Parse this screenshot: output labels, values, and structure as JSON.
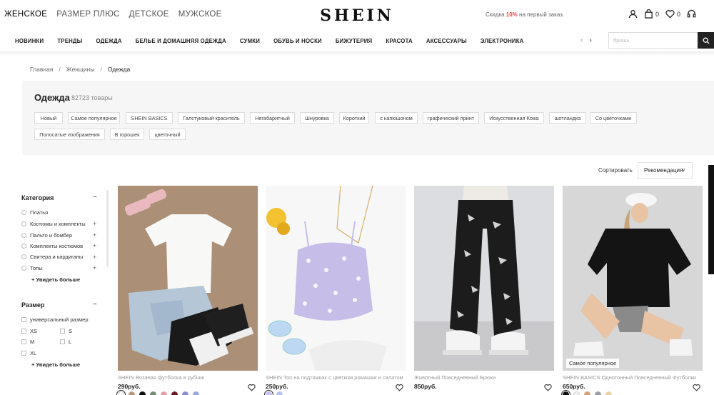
{
  "header": {
    "segments": [
      "ЖЕНСКОЕ",
      "РАЗМЕР ПЛЮС",
      "ДЕТСКОЕ",
      "МУЖСКОЕ"
    ],
    "logo": "SHEIN",
    "promo_prefix": "Скидка",
    "promo_percent": "10%",
    "promo_suffix": "на первый заказ.",
    "cart_count": "0",
    "wishlist_count": "0"
  },
  "nav": {
    "items": [
      "НОВИНКИ",
      "ТРЕНДЫ",
      "ОДЕЖДА",
      "БЕЛЬЕ И ДОМАШНЯЯ ОДЕЖДА",
      "СУМКИ",
      "ОБУВЬ И НОСКИ",
      "БИЖУТЕРИЯ",
      "КРАСОТА",
      "АКСЕССУАРЫ",
      "ЭЛЕКТРОНИКА"
    ],
    "arrow_left": "‹",
    "arrow_right": "›"
  },
  "search": {
    "placeholder": "брошь"
  },
  "breadcrumb": {
    "home": "Главная",
    "women": "Женщины",
    "current": "Одежда",
    "separator": "/"
  },
  "banner": {
    "title": "Одежда",
    "count": "82723 товары",
    "chips": [
      "Новый",
      "Самое популярное",
      "SHEIN BASICS",
      "Галстуковый краситель",
      "Негабаритный",
      "Шнуровка",
      "Короткий",
      "с капюшоном",
      "графический принт",
      "Искусственная Кожа",
      "шотландка",
      "Со цветочками",
      "Полосатые изображения",
      "В горошек",
      "цветочный"
    ]
  },
  "sort": {
    "label": "Сортировать",
    "value": "Рекомендация"
  },
  "filters": {
    "category": {
      "title": "Категория",
      "items": [
        "Платья",
        "Костюмы и комплекты",
        "Пальто и бомбер",
        "Комплекты костюмов",
        "Свитера и кардиганы",
        "Топы"
      ],
      "see_more": "+ Увидеть больше"
    },
    "size": {
      "title": "Размер",
      "items": [
        "универсальный размер",
        "XS",
        "S",
        "M",
        "L",
        "XL"
      ],
      "see_more": "+ Увидеть больше"
    }
  },
  "products": [
    {
      "name": "SHEIN Вязаная футболка в рубчик",
      "price": "290руб.",
      "swatches": [
        "#ffffff",
        "#b89a82",
        "#111111",
        "#7a8c7c",
        "#e8a0a8",
        "#6b1f2a",
        "#8e8fd0",
        "#9aa8de"
      ],
      "selected": 0
    },
    {
      "name": "SHEIN Топ на подтяжках с цветком ромашки и салатом",
      "price": "250руб.",
      "swatches": [
        "#c9c3ee",
        "#b9c4ee"
      ],
      "selected": 0
    },
    {
      "name": "Животный Повседневный Брюки",
      "price": "850руб.",
      "swatches": [],
      "selected": -1
    },
    {
      "name": "SHEIN BASICS Однотонный Повседневный Футболки",
      "price": "650руб.",
      "badge": "Самое популярное",
      "swatches": [
        "#111111",
        "#f2f2f2",
        "#d4a57a",
        "#9aa0a6",
        "#e8d2a8"
      ],
      "selected": 0
    }
  ]
}
